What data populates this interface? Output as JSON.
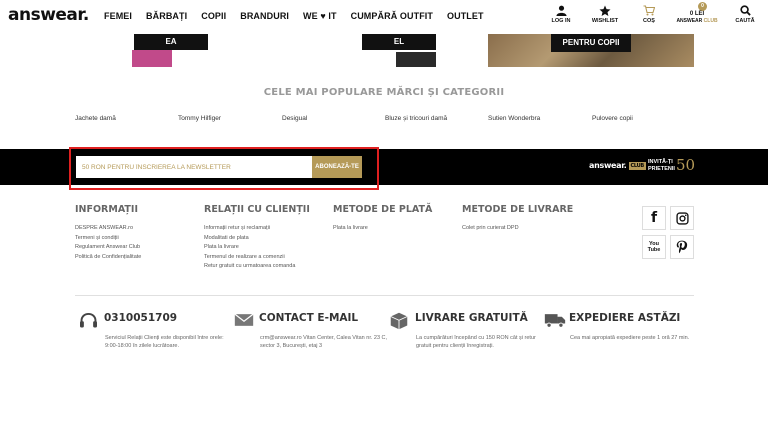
{
  "header": {
    "logo": "answear.",
    "nav": [
      "FEMEI",
      "BĂRBAȚI",
      "COPII",
      "BRANDURI",
      "WE ♥ IT",
      "CUMPĂRĂ OUTFIT",
      "OUTLET"
    ],
    "login_label": "LOG IN",
    "wishlist_label": "WISHLIST",
    "cart_label": "COȘ",
    "cart_count": "0",
    "cart_amount": "0 lei",
    "club_prefix": "ANSWEAR",
    "club_suffix": "CLUB",
    "search_label": "CAUTĂ"
  },
  "hero": {
    "labels": [
      "EA",
      "EL",
      "PENTRU COPII"
    ]
  },
  "popular": {
    "title": "CELE MAI POPULARE MĂRCI ȘI CATEGORII",
    "items": [
      "Jachete damă",
      "Tommy Hilfiger",
      "Desigual",
      "Bluze și tricouri damă",
      "Sutien Wonderbra",
      "Pulovere copii"
    ]
  },
  "newsletter": {
    "placeholder": "50 RON PENTRU ÎNSCRIEREA LA NEWSLETTER",
    "button_label": "ABONEAZĂ-TE",
    "club_logo": "answear.",
    "club_badge": "CLUB",
    "invite_line1": "INVITĂ-ȚI",
    "invite_line2": "PRIETENII",
    "invite_amount": "50"
  },
  "footer": {
    "columns": [
      {
        "title": "INFORMAȚII",
        "links": [
          "DESPRE ANSWEAR.ro",
          "Termeni și condiții",
          "Regulament Answear Club",
          "Politică de Confidențialitate"
        ]
      },
      {
        "title": "RELAȚII CU CLIENȚII",
        "links": [
          "Informații retur și reclamații",
          "Modalitati de plata",
          "Plata la livrare",
          "Termenul de realizare a comenzii",
          "Retur gratuit cu urmatoarea comanda"
        ]
      },
      {
        "title": "METODE DE PLATĂ",
        "links": [
          "Plata la livrare"
        ]
      },
      {
        "title": "METODE DE LIVRARE",
        "links": [
          "Colet prin curierat DPD"
        ]
      }
    ],
    "social": [
      "f",
      "You Tube"
    ]
  },
  "info": [
    {
      "title": "0310051709",
      "text": "Serviciul Relații Clienți este disponibil între orele: 9:00-18:00 în zilele lucrătoare."
    },
    {
      "title": "CONTACT E-MAIL",
      "text": "crm@answear.ro Vitan Center, Calea Vitan nr. 23 C, sector 3, București, etaj 3"
    },
    {
      "title": "LIVRARE GRATUITĂ",
      "text": "La cumpărături începând cu 150 RON cât și retur gratuit pentru clienții înregistrați."
    },
    {
      "title": "EXPEDIERE ASTĂZI",
      "text": "Cea mai apropiată expediere peste 1 oră 27 min."
    }
  ],
  "colors": {
    "accent": "#b59a58",
    "band": "#000000",
    "highlight": "#e02020"
  }
}
